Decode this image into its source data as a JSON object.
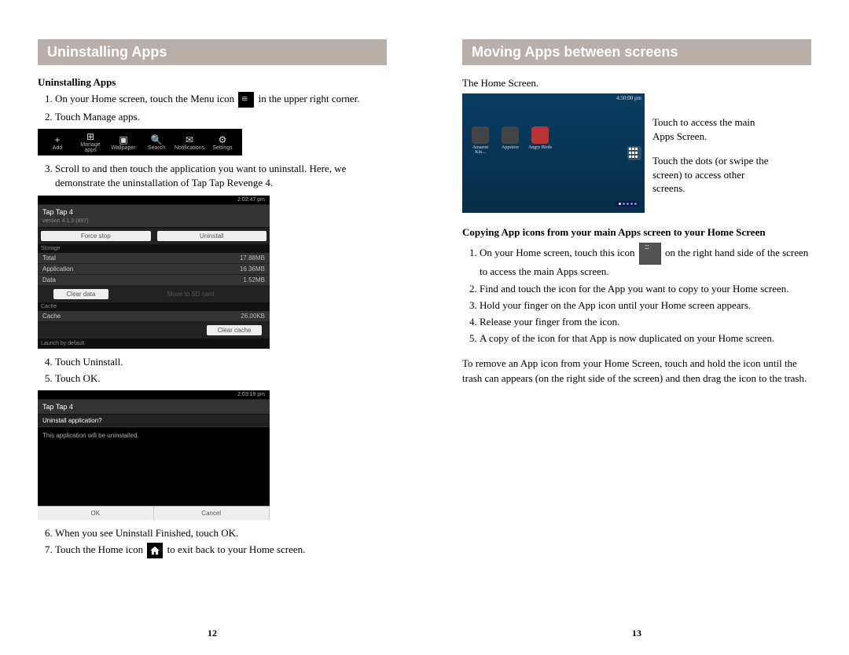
{
  "left": {
    "header": "Uninstalling Apps",
    "subheader": "Uninstalling Apps",
    "step1a": "On your Home screen, touch the Menu icon",
    "step1b": "in the upper right corner.",
    "step2": "Touch Manage apps.",
    "step3": "Scroll to and then touch the application you want to uninstall. Here, we demonstrate the uninstallation of Tap Tap Revenge 4.",
    "step4": "Touch Uninstall.",
    "step5": "Touch OK.",
    "step6": "When you see Uninstall Finished, touch OK.",
    "step7a": "Touch the Home icon",
    "step7b": "to exit back to your Home screen.",
    "pagenum": "12",
    "shot_toolbar": {
      "items": [
        {
          "icon": "+",
          "label": "Add"
        },
        {
          "icon": "⊞",
          "label": "Manage apps"
        },
        {
          "icon": "▣",
          "label": "Wallpaper"
        },
        {
          "icon": "🔍",
          "label": "Search"
        },
        {
          "icon": "✉",
          "label": "Notifications"
        },
        {
          "icon": "⚙",
          "label": "Settings"
        }
      ]
    },
    "shot_detail": {
      "time": "2:02:47 pm",
      "app_name": "Tap Tap 4",
      "version": "version 4.1.3 (897)",
      "btn_force": "Force stop",
      "btn_uninstall": "Uninstall",
      "sec_storage": "Storage",
      "row_total": "Total",
      "row_total_v": "17.88MB",
      "row_app": "Application",
      "row_app_v": "16.36MB",
      "row_data": "Data",
      "row_data_v": "1.52MB",
      "btn_clear_data": "Clear data",
      "btn_move_sd": "Move to SD card",
      "sec_cache": "Cache",
      "row_cache": "Cache",
      "row_cache_v": "26.00KB",
      "btn_clear_cache": "Clear cache",
      "launch": "Launch by default"
    },
    "shot_conf": {
      "time": "2:03:19 pm",
      "app_name": "Tap Tap 4",
      "q": "Uninstall application?",
      "msg": "This application will be uninstalled.",
      "ok": "OK",
      "cancel": "Cancel"
    }
  },
  "right": {
    "header": "Moving Apps between screens",
    "line1": "The Home Screen.",
    "annot1": "Touch to access the main Apps Screen.",
    "annot2": "Touch the dots (or swipe the screen) to access other screens.",
    "home_shot": {
      "time": "4:50:00 pm",
      "apps": [
        "Amazon Kin...",
        "Appstore",
        "Angry Birds"
      ]
    },
    "sub2": "Copying App icons from your main Apps screen to your Home Screen",
    "cstep1a": "On your Home screen, touch this icon",
    "cstep1b": "on the right hand side of the screen to access the main Apps screen.",
    "cstep2": "Find and touch the icon for the App you want to copy to your Home screen.",
    "cstep3": "Hold your finger on the App icon until your Home screen appears.",
    "cstep4": "Release your finger from the icon.",
    "cstep5": "A copy of the icon for that App is now duplicated on your Home screen.",
    "remove_para": "To remove an App icon from your Home Screen, touch and hold the icon until the trash can appears (on the right side of the screen) and then drag the icon to the trash.",
    "pagenum": "13"
  }
}
